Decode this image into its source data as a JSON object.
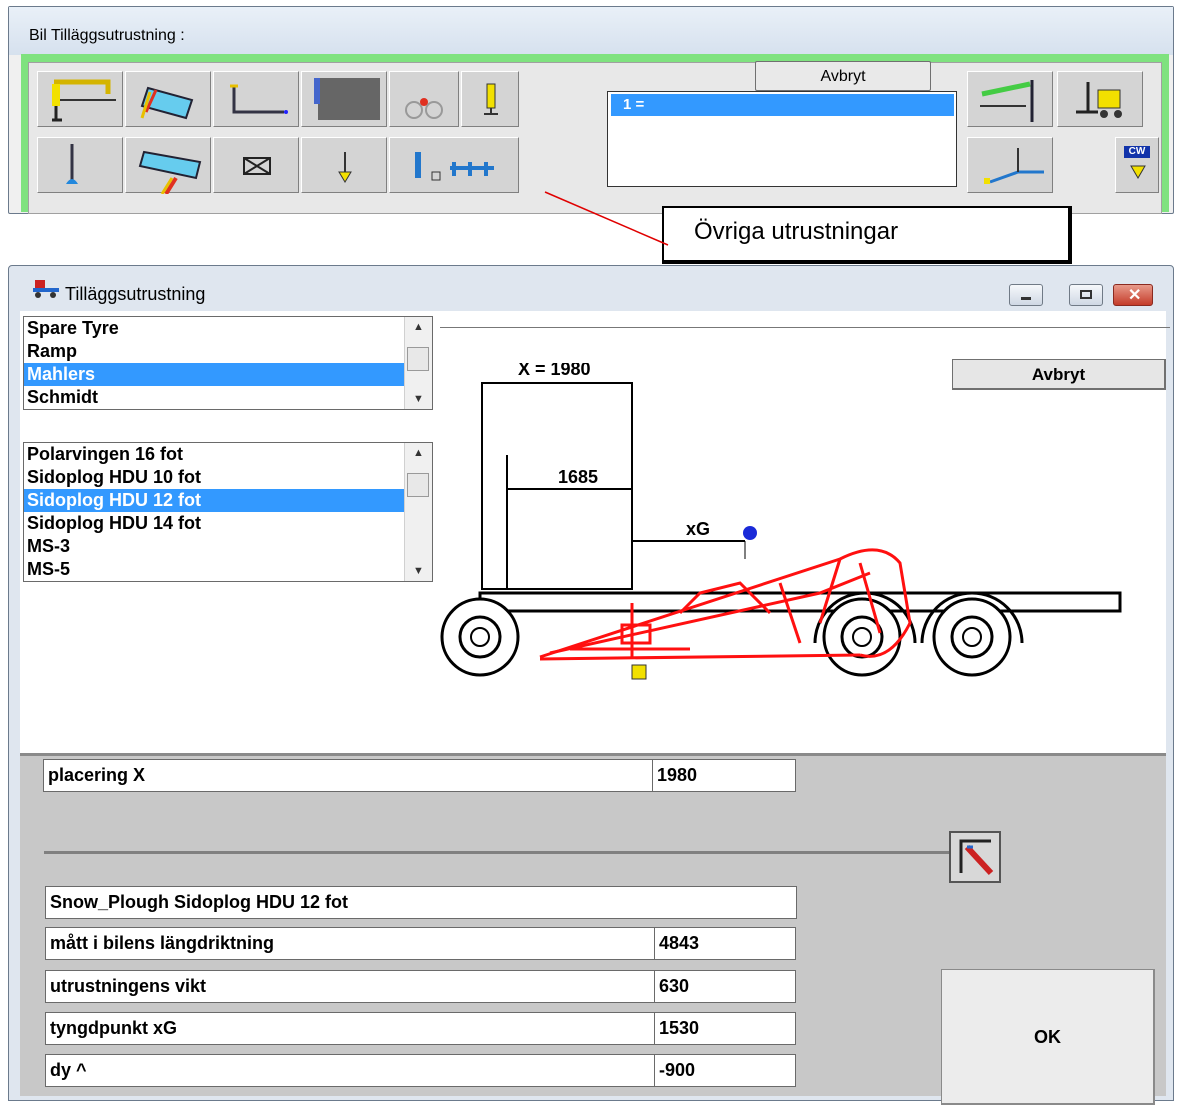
{
  "toolbar_window": {
    "title": "Bil Tilläggsutrustning :",
    "cancel_label": "Avbryt",
    "list_items": [
      "1 ="
    ],
    "buttons_row1": [
      "crane-icon",
      "tipper-icon",
      "hooklift-icon",
      "box-body-icon",
      "tandem-axle-icon",
      "support-leg-icon"
    ],
    "buttons_row2": [
      "stabilizer-leg-icon",
      "rear-tipper-icon",
      "cross-box-icon",
      "down-arrow-icon",
      "other-equipment-icon"
    ],
    "buttons_right": [
      "rear-crane-icon",
      "forklift-icon",
      "tail-lift-icon",
      "counterweight-icon"
    ],
    "counterweight_label": "CW"
  },
  "callout": {
    "text": "Övriga utrustningar"
  },
  "dialog": {
    "title": "Tilläggsutrustning",
    "cancel_label": "Avbryt",
    "category_list": {
      "items": [
        "Spare Tyre",
        "Ramp",
        "Mahlers",
        "Schmidt"
      ],
      "selected": "Mahlers"
    },
    "model_list": {
      "items": [
        "Polarvingen 16 fot",
        "Sidoplog HDU 10 fot",
        "Sidoplog HDU 12 fot",
        "Sidoplog HDU 14 fot",
        "MS-3",
        "MS-5"
      ],
      "selected": "Sidoplog HDU 12 fot"
    },
    "drawing": {
      "dim_x_label": "X = 1980",
      "dim_1685_label": "1685",
      "xg_label": "xG"
    },
    "placement": {
      "label": "placering  X",
      "value": "1980"
    },
    "equipment_name": "Snow_Plough  Sidoplog HDU 12 fot",
    "rows": [
      {
        "label": "mått i bilens längdriktning",
        "value": "4843"
      },
      {
        "label": "utrustningens vikt",
        "value": "630"
      },
      {
        "label": "tyngdpunkt  xG",
        "value": "1530"
      },
      {
        "label": "dy    ^",
        "value": "-900"
      }
    ],
    "ok_label": "OK"
  },
  "colors": {
    "selection": "#3399ff",
    "plough": "#ff0000",
    "toolbar_border": "#7fe27f"
  }
}
